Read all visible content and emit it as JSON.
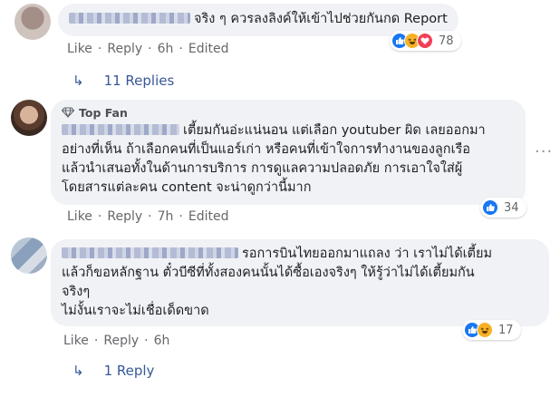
{
  "comments": [
    {
      "text": "จริง ๆ ควรลงลิงค์ให้เข้าไปช่วยกันกด Report",
      "actions": {
        "like": "Like",
        "reply": "Reply",
        "time": "6h",
        "edited": "Edited"
      },
      "reactions": {
        "icons": [
          "like-icon",
          "haha-icon",
          "love-icon"
        ],
        "count": "78"
      },
      "replies": "11 Replies"
    },
    {
      "badge": "Top Fan",
      "text_lines": [
        "เตี้ยมกันอ่ะแน่นอน แต่เลือก youtuber ผิด เลยออกมา",
        "อย่างที่เห็น ถ้าเลือกคนที่เป็นแอร์เก่า หรือคนที่เข้าใจการทำงานของลูกเรือ",
        "แล้วนำเสนอทั้งในด้านการบริการ การดูแลความปลอดภัย การเอาใจใส่ผู้",
        "โดยสารแต่ละคน content จะน่าดูกว่านี้มาก"
      ],
      "actions": {
        "like": "Like",
        "reply": "Reply",
        "time": "7h",
        "edited": "Edited"
      },
      "reactions": {
        "icons": [
          "like-icon"
        ],
        "count": "34"
      }
    },
    {
      "text_lines": [
        "รอการบินไทยออกมาแถลง ว่า เราไม่ได้เตี้ยม",
        "แล้วก็ขอหลักฐาน ตั๋วบีซีที่ทั้งสองคนนั้นได้ซื้อเองจริงๆ ให้รู้ว่าไม่ได้เตี้ยมกัน",
        "จริงๆ",
        "ไม่งั้นเราจะไม่เชื่อเด็ดขาด"
      ],
      "actions": {
        "like": "Like",
        "reply": "Reply",
        "time": "6h"
      },
      "reactions": {
        "icons": [
          "like-icon",
          "haha-icon"
        ],
        "count": "17"
      },
      "replies": "1 Reply"
    }
  ],
  "more_options": "···",
  "colors": {
    "link": "#385898",
    "meta": "#65676b",
    "bubble": "#f0f2f5",
    "like": "#1877f2"
  }
}
